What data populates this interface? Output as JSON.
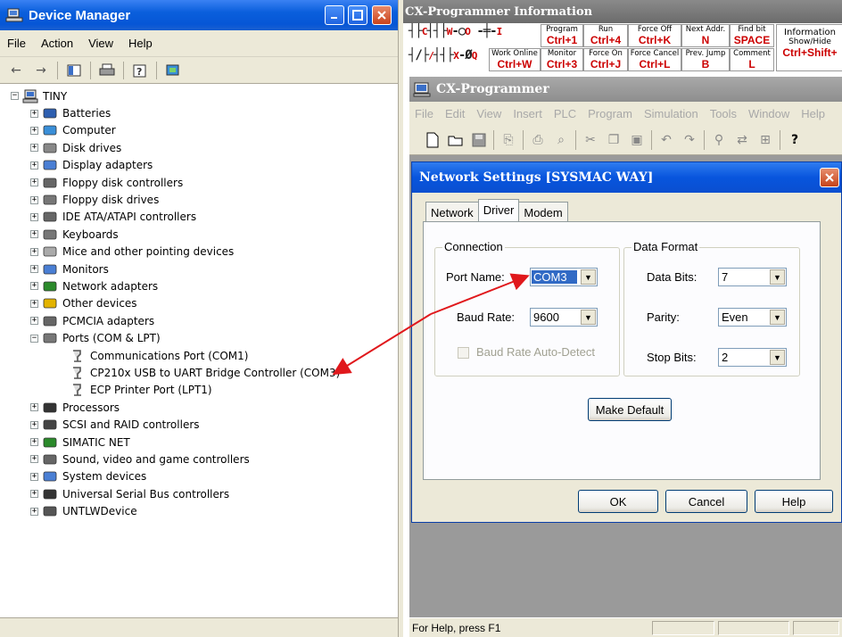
{
  "device_manager": {
    "title": "Device Manager",
    "menu": [
      "File",
      "Action",
      "View",
      "Help"
    ],
    "tree": {
      "root": "TINY",
      "categories": [
        {
          "label": "Batteries",
          "icon": "battery-icon"
        },
        {
          "label": "Computer",
          "icon": "computer-icon"
        },
        {
          "label": "Disk drives",
          "icon": "disk-drive-icon"
        },
        {
          "label": "Display adapters",
          "icon": "display-adapter-icon"
        },
        {
          "label": "Floppy disk controllers",
          "icon": "floppy-controller-icon"
        },
        {
          "label": "Floppy disk drives",
          "icon": "floppy-drive-icon"
        },
        {
          "label": "IDE ATA/ATAPI controllers",
          "icon": "ide-controller-icon"
        },
        {
          "label": "Keyboards",
          "icon": "keyboard-icon"
        },
        {
          "label": "Mice and other pointing devices",
          "icon": "mouse-icon"
        },
        {
          "label": "Monitors",
          "icon": "monitor-icon"
        },
        {
          "label": "Network adapters",
          "icon": "network-adapter-icon"
        },
        {
          "label": "Other devices",
          "icon": "other-devices-icon"
        },
        {
          "label": "PCMCIA adapters",
          "icon": "pcmcia-icon"
        },
        {
          "label": "Ports (COM & LPT)",
          "icon": "port-icon",
          "expanded": true
        },
        {
          "label": "Processors",
          "icon": "processor-icon"
        },
        {
          "label": "SCSI and RAID controllers",
          "icon": "scsi-icon"
        },
        {
          "label": "SIMATIC NET",
          "icon": "simatic-net-icon"
        },
        {
          "label": "Sound, video and game controllers",
          "icon": "sound-icon"
        },
        {
          "label": "System devices",
          "icon": "system-devices-icon"
        },
        {
          "label": "Universal Serial Bus controllers",
          "icon": "usb-icon"
        },
        {
          "label": "UNTLWDevice",
          "icon": "device-icon"
        }
      ],
      "ports_children": [
        "Communications Port (COM1)",
        "CP210x USB to UART Bridge Controller (COM3)",
        "ECP Printer Port (LPT1)"
      ]
    }
  },
  "cx_info": {
    "title": "CX-Programmer Information",
    "shortcuts": [
      {
        "top": "Program",
        "key": "Ctrl+1"
      },
      {
        "top": "Run",
        "key": "Ctrl+4"
      },
      {
        "top": "Force Off",
        "key": "Ctrl+K"
      },
      {
        "top": "Next Addr.",
        "key": "N"
      },
      {
        "top": "Find bit",
        "key": "SPACE"
      },
      {
        "top": "Work Online",
        "key": "Ctrl+W"
      },
      {
        "top": "Monitor",
        "key": "Ctrl+3"
      },
      {
        "top": "Force On",
        "key": "Ctrl+J"
      },
      {
        "top": "Force Cancel",
        "key": "Ctrl+L"
      },
      {
        "top": "Prev. Jump",
        "key": "B"
      },
      {
        "top": "Comment",
        "key": "L"
      }
    ],
    "info_top": "Information",
    "info_sub": "Show/Hide",
    "info_key": "Ctrl+Shift+"
  },
  "cx_programmer": {
    "title": "CX-Programmer",
    "menu": [
      "File",
      "Edit",
      "View",
      "Insert",
      "PLC",
      "Program",
      "Simulation",
      "Tools",
      "Window",
      "Help"
    ],
    "status_text": "For Help, press F1"
  },
  "network_dialog": {
    "title": "Network Settings [SYSMAC WAY]",
    "tabs": [
      "Network",
      "Driver",
      "Modem"
    ],
    "active_tab": "Driver",
    "connection": {
      "legend": "Connection",
      "port_label": "Port Name:",
      "port_value": "COM3",
      "baud_label": "Baud Rate:",
      "baud_value": "9600",
      "autodetect_label": "Baud Rate Auto-Detect"
    },
    "data_format": {
      "legend": "Data Format",
      "data_bits_label": "Data Bits:",
      "data_bits_value": "7",
      "parity_label": "Parity:",
      "parity_value": "Even",
      "stop_bits_label": "Stop Bits:",
      "stop_bits_value": "2"
    },
    "make_default": "Make Default",
    "ok": "OK",
    "cancel": "Cancel",
    "help": "Help"
  },
  "colors": {
    "xp_title_blue": "#0a5fdc",
    "annotation_arrow": "#e0181c",
    "selection_blue": "#316ac5"
  }
}
